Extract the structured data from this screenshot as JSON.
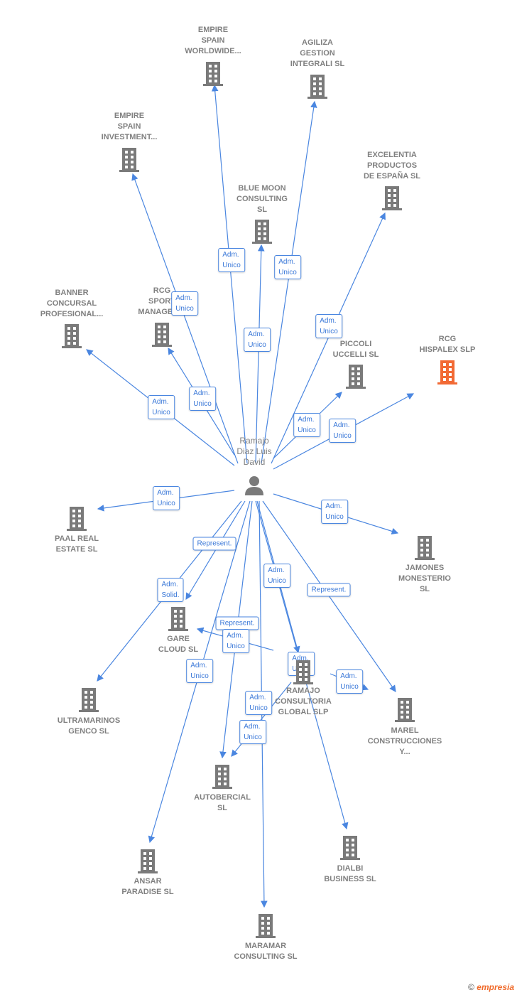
{
  "center": {
    "name": "Ramajo\nDiaz Luis\nDavid",
    "icon": "person-icon"
  },
  "colors": {
    "edge": "#4a86e0",
    "company": "#7a7a7a",
    "highlight": "#f26a35"
  },
  "companies": [
    {
      "name": "EMPIRE\nSPAIN\nWORLDWIDE..."
    },
    {
      "name": "AGILIZA\nGESTION\nINTEGRALI  SL"
    },
    {
      "name": "EMPIRE\nSPAIN\nINVESTMENT..."
    },
    {
      "name": "BLUE MOON\nCONSULTING\nSL"
    },
    {
      "name": "EXCELENTIA\nPRODUCTOS\nDE ESPAÑA  SL"
    },
    {
      "name": "BANNER\nCONCURSAL\nPROFESIONAL..."
    },
    {
      "name": "RCG\nSPORT\nMANAGEM..."
    },
    {
      "name": "RCG\nHISPALEX  SLP",
      "highlight": true
    },
    {
      "name": "PICCOLI\nUCCELLI  SL"
    },
    {
      "name": "PAAL REAL\nESTATE  SL"
    },
    {
      "name": "JAMONES\nMONESTERIO\nSL"
    },
    {
      "name": "GARE\nCLOUD  SL"
    },
    {
      "name": "ULTRAMARINOS\nGENCO  SL"
    },
    {
      "name": "RAMAJO\nCONSULTORIA\nGLOBAL  SLP"
    },
    {
      "name": "MAREL\nCONSTRUCCIONES\nY..."
    },
    {
      "name": "AUTOBERCIAL\nSL"
    },
    {
      "name": "DIALBI\nBUSINESS  SL"
    },
    {
      "name": "ANSAR\nPARADISE  SL"
    },
    {
      "name": "MARAMAR\nCONSULTING SL"
    }
  ],
  "edges": [
    {
      "label": "Adm.\nUnico"
    },
    {
      "label": "Adm.\nUnico"
    },
    {
      "label": "Adm.\nUnico"
    },
    {
      "label": "Adm.\nUnico"
    },
    {
      "label": "Adm.\nUnico"
    },
    {
      "label": "Adm.\nUnico"
    },
    {
      "label": "Adm.\nUnico"
    },
    {
      "label": "Adm.\nUnico"
    },
    {
      "label": "Adm.\nUnico"
    },
    {
      "label": "Adm.\nUnico"
    },
    {
      "label": "Adm.\nUnico"
    },
    {
      "label": "Represent."
    },
    {
      "label": "Adm.\nSolid."
    },
    {
      "label": "Adm.\nUnico"
    },
    {
      "label": "Represent."
    },
    {
      "label": "Represent."
    },
    {
      "label": "Adm.\nUnico"
    },
    {
      "label": "Adm.\nUnico"
    },
    {
      "label": "Adm.\nUnico"
    },
    {
      "label": "Adm.\nUnico"
    },
    {
      "label": "Adm.\nUnico"
    },
    {
      "label": "Adm.\nUnico"
    }
  ],
  "footer": {
    "copyright": "©",
    "brand": "empresia"
  }
}
